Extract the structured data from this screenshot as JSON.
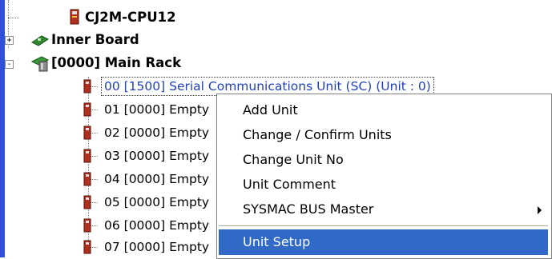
{
  "tree": {
    "nodes": [
      {
        "label": "CJ2M-CPU12",
        "icon": "cpu-icon"
      },
      {
        "label": "Inner Board",
        "icon": "board-icon",
        "expander": "+"
      },
      {
        "label": "[0000] Main Rack",
        "icon": "rack-icon",
        "expander": "-"
      }
    ],
    "units": [
      "00 [1500] Serial Communications Unit (SC) (Unit : 0)",
      "01 [0000] Empty",
      "02 [0000] Empty",
      "03 [0000] Empty",
      "04 [0000] Empty",
      "05 [0000] Empty",
      "06 [0000] Empty",
      "07 [0000] Empty"
    ]
  },
  "context_menu": {
    "items": [
      "Add Unit",
      "Change / Confirm Units",
      "Change Unit No",
      "Unit Comment",
      "SYSMAC BUS Master",
      "Unit Setup"
    ],
    "active_index": 5,
    "submenu_index": 4
  },
  "colors": {
    "selection": "#3169c6",
    "left_bar": "#2f4fd8",
    "link_text": "#1f3fbf"
  }
}
